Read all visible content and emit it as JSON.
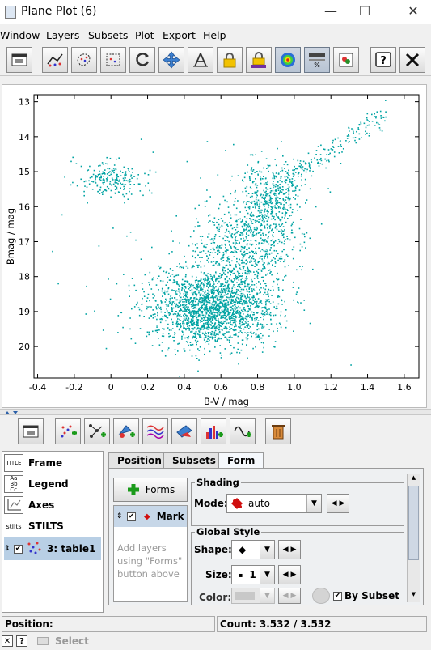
{
  "window": {
    "title": "Plane Plot (6)",
    "minimize": "—",
    "maximize": "☐",
    "close": "✕"
  },
  "menubar": [
    "Window",
    "Layers",
    "Subsets",
    "Plot",
    "Export",
    "Help"
  ],
  "toolbar": {
    "buttons": [
      "new-window-icon",
      "line-plot-icon",
      "lasso-subset-icon",
      "rectangle-subset-icon",
      "replot-icon",
      "navigate-icon",
      "axis-lock-icon",
      "lock-icon",
      "lock-color-icon",
      "heatmap-icon",
      "sketch-icon",
      "legend-icon",
      "help-icon",
      "close-icon"
    ]
  },
  "plot": {
    "xlabel": "B-V / mag",
    "ylabel": "Bmag / mag",
    "xticks": [
      "-0.4",
      "-0.2",
      "0",
      "0.2",
      "0.4",
      "0.6",
      "0.8",
      "1.0",
      "1.2",
      "1.4",
      "1.6"
    ],
    "yticks": [
      "13",
      "14",
      "15",
      "16",
      "17",
      "18",
      "19",
      "20"
    ],
    "point_color": "#00a3a3"
  },
  "chart_data": {
    "type": "scatter",
    "title": "",
    "xlabel": "B-V / mag",
    "ylabel": "Bmag / mag",
    "xlim": [
      -0.42,
      1.68
    ],
    "ylim": [
      20.9,
      12.8
    ],
    "y_inverted": true,
    "grid": false,
    "n_points": 3532,
    "clusters": [
      {
        "name": "",
        "xmean": 0.55,
        "xsd": 0.17,
        "ymean": 18.9,
        "ysd": 0.55,
        "weight": 0.55
      },
      {
        "name": "",
        "xmean": 0.72,
        "xsd": 0.13,
        "ymean": 17.2,
        "ysd": 0.7,
        "weight": 0.2
      },
      {
        "name": "",
        "xmean": 0.88,
        "xsd": 0.08,
        "ymean": 15.7,
        "ysd": 0.5,
        "weight": 0.12
      },
      {
        "name": "",
        "xmean": 0.0,
        "xsd": 0.09,
        "ymean": 15.2,
        "ysd": 0.25,
        "weight": 0.06
      },
      {
        "name": "",
        "xmean": 1.2,
        "xsd": 0.15,
        "ymean": 14.1,
        "ysd": 0.25,
        "weight": 0.05
      },
      {
        "name": "",
        "xmean": 0.5,
        "xsd": 0.45,
        "ymean": 17.5,
        "ysd": 2.0,
        "weight": 0.02
      }
    ]
  },
  "controlbar": {
    "buttons": [
      "frame-window-icon",
      "add-scatter-layer-icon",
      "add-pair-layer-icon",
      "add-marker-layer-icon",
      "add-histogram-layer-icon",
      "add-area-layer-icon",
      "add-bar-layer-icon",
      "add-function-layer-icon",
      "delete-layer-icon"
    ]
  },
  "stack": {
    "items": [
      {
        "label": "Frame",
        "icon": "frame-icon"
      },
      {
        "label": "Legend",
        "icon": "legend-icon"
      },
      {
        "label": "Axes",
        "icon": "axes-icon"
      },
      {
        "label": "STILTS",
        "icon": "stilts-icon"
      },
      {
        "label": "3: table1",
        "icon": "table-layer-icon"
      }
    ],
    "frame_icon_text": "TITLE",
    "legend_icon_text": "Aa\nBb\nCc",
    "stilts_icon_text": "stilts"
  },
  "tabs": [
    "Position",
    "Subsets",
    "Form"
  ],
  "form": {
    "forms_button": "Forms",
    "layer_label": "Mark",
    "hint": "Add layers using \"Forms\" button above",
    "shading_title": "Shading",
    "mode_label": "Mode:",
    "mode_value": "auto",
    "global_style_title": "Global Style",
    "shape_label": "Shape:",
    "size_label": "Size:",
    "size_value": "1",
    "color_label": "Color:",
    "by_subset_label": "By Subset"
  },
  "status": {
    "position_label": "Position:",
    "count_text": "Count: 3.532 / 3.532",
    "select_label": "Select"
  }
}
